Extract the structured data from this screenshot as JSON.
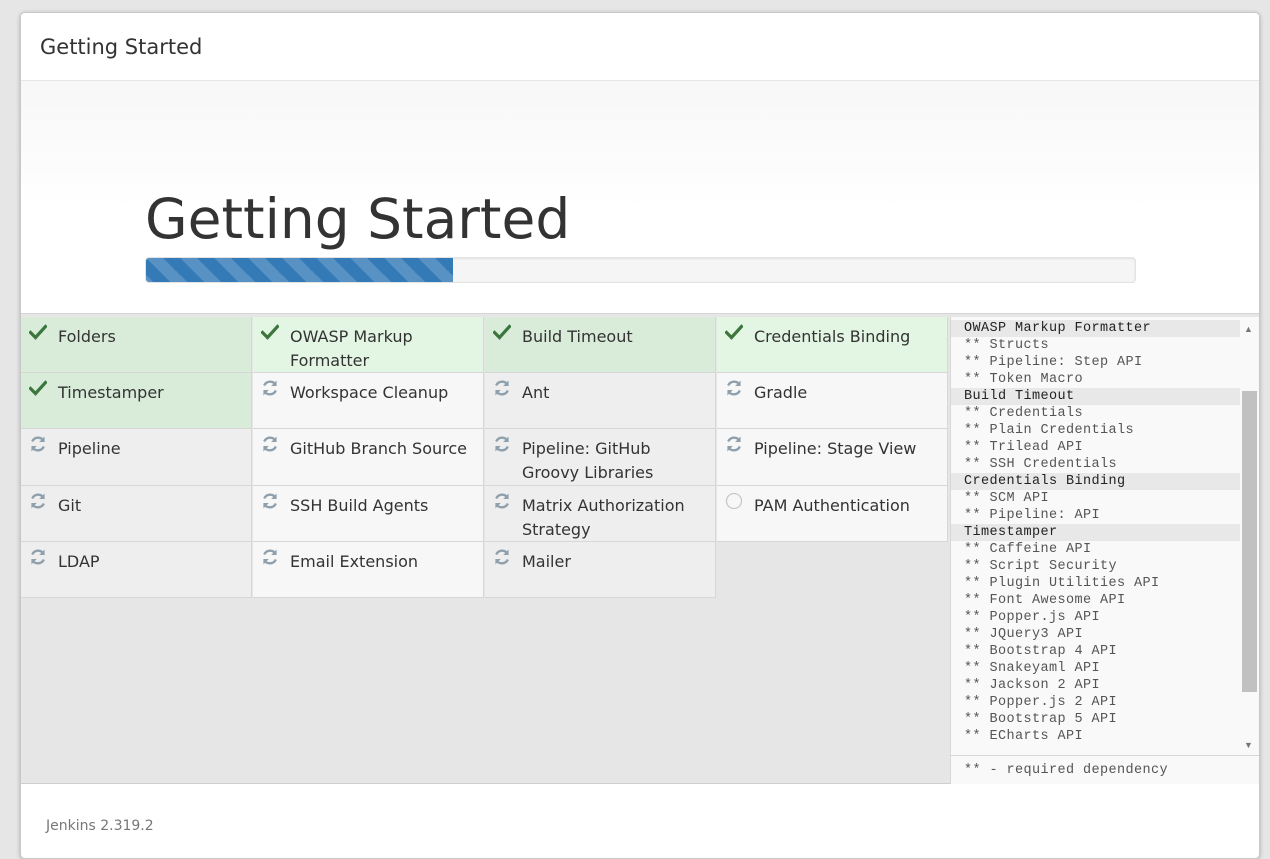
{
  "dialog": {
    "title": "Getting Started"
  },
  "hero": {
    "title": "Getting Started",
    "progress": 0.31
  },
  "colors": {
    "progress_bar": "#337ab7",
    "success_icon": "#3c763d",
    "pending_icon": "#8ea0ad",
    "success_bg": "#d9ebd9"
  },
  "plugins": [
    {
      "label": "Folders",
      "status": "success",
      "icon": "check-icon"
    },
    {
      "label": "OWASP Markup Formatter",
      "status": "success",
      "icon": "check-icon"
    },
    {
      "label": "Build Timeout",
      "status": "success",
      "icon": "check-icon"
    },
    {
      "label": "Credentials Binding",
      "status": "success",
      "icon": "check-icon"
    },
    {
      "label": "Timestamper",
      "status": "success",
      "icon": "check-icon"
    },
    {
      "label": "Workspace Cleanup",
      "status": "installing",
      "icon": "refresh-icon"
    },
    {
      "label": "Ant",
      "status": "installing",
      "icon": "refresh-icon"
    },
    {
      "label": "Gradle",
      "status": "installing",
      "icon": "refresh-icon"
    },
    {
      "label": "Pipeline",
      "status": "installing",
      "icon": "refresh-icon"
    },
    {
      "label": "GitHub Branch Source",
      "status": "installing",
      "icon": "refresh-icon"
    },
    {
      "label": "Pipeline: GitHub Groovy Libraries",
      "status": "installing",
      "icon": "refresh-icon"
    },
    {
      "label": "Pipeline: Stage View",
      "status": "installing",
      "icon": "refresh-icon"
    },
    {
      "label": "Git",
      "status": "installing",
      "icon": "refresh-icon"
    },
    {
      "label": "SSH Build Agents",
      "status": "installing",
      "icon": "refresh-icon"
    },
    {
      "label": "Matrix Authorization Strategy",
      "status": "installing",
      "icon": "refresh-icon"
    },
    {
      "label": "PAM Authentication",
      "status": "pending",
      "icon": "circle-icon"
    },
    {
      "label": "LDAP",
      "status": "installing",
      "icon": "refresh-icon"
    },
    {
      "label": "Email Extension",
      "status": "installing",
      "icon": "refresh-icon"
    },
    {
      "label": "Mailer",
      "status": "installing",
      "icon": "refresh-icon"
    }
  ],
  "log": {
    "lines": [
      {
        "text": "OWASP Markup Formatter",
        "heading": true
      },
      {
        "text": "** Structs",
        "heading": false
      },
      {
        "text": "** Pipeline: Step API",
        "heading": false
      },
      {
        "text": "** Token Macro",
        "heading": false
      },
      {
        "text": "Build Timeout",
        "heading": true
      },
      {
        "text": "** Credentials",
        "heading": false
      },
      {
        "text": "** Plain Credentials",
        "heading": false
      },
      {
        "text": "** Trilead API",
        "heading": false
      },
      {
        "text": "** SSH Credentials",
        "heading": false
      },
      {
        "text": "Credentials Binding",
        "heading": true
      },
      {
        "text": "** SCM API",
        "heading": false
      },
      {
        "text": "** Pipeline: API",
        "heading": false
      },
      {
        "text": "Timestamper",
        "heading": true
      },
      {
        "text": "** Caffeine API",
        "heading": false
      },
      {
        "text": "** Script Security",
        "heading": false
      },
      {
        "text": "** Plugin Utilities API",
        "heading": false
      },
      {
        "text": "** Font Awesome API",
        "heading": false
      },
      {
        "text": "** Popper.js API",
        "heading": false
      },
      {
        "text": "** JQuery3 API",
        "heading": false
      },
      {
        "text": "** Bootstrap 4 API",
        "heading": false
      },
      {
        "text": "** Snakeyaml API",
        "heading": false
      },
      {
        "text": "** Jackson 2 API",
        "heading": false
      },
      {
        "text": "** Popper.js 2 API",
        "heading": false
      },
      {
        "text": "** Bootstrap 5 API",
        "heading": false
      },
      {
        "text": "** ECharts API",
        "heading": false
      }
    ],
    "footer": "** - required dependency"
  },
  "footer": {
    "version": "Jenkins 2.319.2"
  }
}
